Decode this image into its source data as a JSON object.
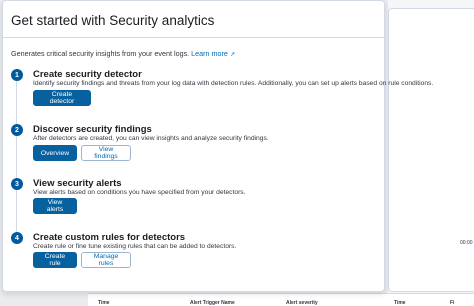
{
  "panel": {
    "title": "Get started with Security analytics",
    "description": "Generates critical security insights from your event logs.",
    "learn_more": "Learn more",
    "external_icon": "external-link-icon"
  },
  "steps": [
    {
      "number": "1",
      "title": "Create security detector",
      "description": "Identify security findings and threats from your log data with detection rules. Additionally, you can set up alerts based on rule conditions.",
      "buttons": [
        "Create detector"
      ]
    },
    {
      "number": "2",
      "title": "Discover security findings",
      "description": "After detectors are created, you can view insights and analyze security findings.",
      "buttons": [
        "Overview",
        "View findings"
      ]
    },
    {
      "number": "3",
      "title": "View security alerts",
      "description": "View alerts based on conditions you have specified from your detectors.",
      "buttons": [
        "View alerts"
      ]
    },
    {
      "number": "4",
      "title": "Create custom rules for detectors",
      "description": "Create rule or fine tune existing rules that can be added to detectors.",
      "buttons": [
        "Create rule",
        "Manage rules"
      ]
    }
  ],
  "background": {
    "tick_label": "00:00",
    "table_columns": [
      "Time",
      "Alert Trigger Name",
      "Alert severity"
    ],
    "right_table_columns": [
      "Time",
      "Fi"
    ]
  },
  "colors": {
    "primary": "#07619f",
    "step_badge": "#005a9e",
    "link": "#006bb8"
  }
}
